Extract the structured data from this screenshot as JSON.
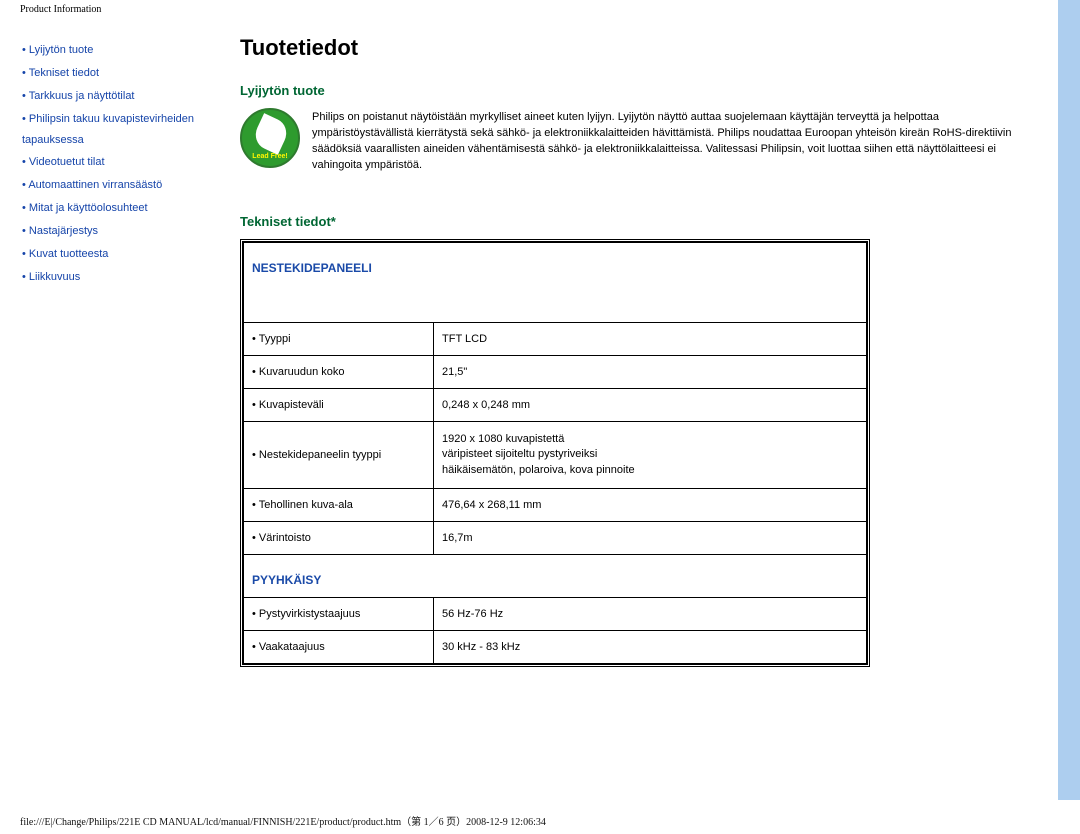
{
  "top_label": "Product Information",
  "sidebar": {
    "items": [
      {
        "label": "Lyijytön tuote"
      },
      {
        "label": "Tekniset tiedot"
      },
      {
        "label": "Tarkkuus ja näyttötilat"
      },
      {
        "label": "Philipsin takuu kuvapistevirheiden tapauksessa"
      },
      {
        "label": "Videotuetut tilat"
      },
      {
        "label": "Automaattinen virransäästö"
      },
      {
        "label": "Mitat ja käyttöolosuhteet"
      },
      {
        "label": "Nastajärjestys"
      },
      {
        "label": "Kuvat tuotteesta"
      },
      {
        "label": "Liikkuvuus"
      }
    ]
  },
  "main": {
    "title": "Tuotetiedot",
    "lead_header": "Lyijytön tuote",
    "lead_text": "Philips on poistanut näytöistään myrkylliset aineet kuten lyijyn. Lyijytön näyttö auttaa suojelemaan käyttäjän terveyttä ja helpottaa ympäristöystävällistä kierrätystä sekä sähkö- ja elektroniikkalaitteiden hävittämistä. Philips noudattaa Euroopan yhteisön kireän RoHS-direktiivin säädöksiä vaarallisten aineiden vähentämisestä sähkö- ja elektroniikkalaitteissa. Valitessasi Philipsin, voit luottaa siihen että näyttölaitteesi ei vahingoita ympäristöä.",
    "spec_header": "Tekniset tiedot*",
    "lcd_header": "NESTEKIDEPANEELI",
    "rows_lcd": [
      {
        "label": "Tyyppi",
        "value": "TFT LCD"
      },
      {
        "label": "Kuvaruudun koko",
        "value": "21,5\""
      },
      {
        "label": "Kuvapisteväli",
        "value": "0,248 x 0,248 mm"
      },
      {
        "label": "Nestekidepaneelin tyyppi",
        "value": "1920 x 1080 kuvapistettä\nväripisteet sijoiteltu pystyriveiksi\nhäikäisemätön, polaroiva, kova pinnoite"
      },
      {
        "label": "Tehollinen kuva-ala",
        "value": "476,64 x 268,11 mm"
      },
      {
        "label": "Värintoisto",
        "value": "16,7m"
      }
    ],
    "scan_header": "PYYHKÄISY",
    "rows_scan": [
      {
        "label": "Pystyvirkistystaajuus",
        "value": "56 Hz-76 Hz"
      },
      {
        "label": "Vaakataajuus",
        "value": "30 kHz - 83 kHz"
      }
    ]
  },
  "footer": "file:///E|/Change/Philips/221E CD MANUAL/lcd/manual/FINNISH/221E/product/product.htm（第 1／6 页）2008-12-9 12:06:34"
}
